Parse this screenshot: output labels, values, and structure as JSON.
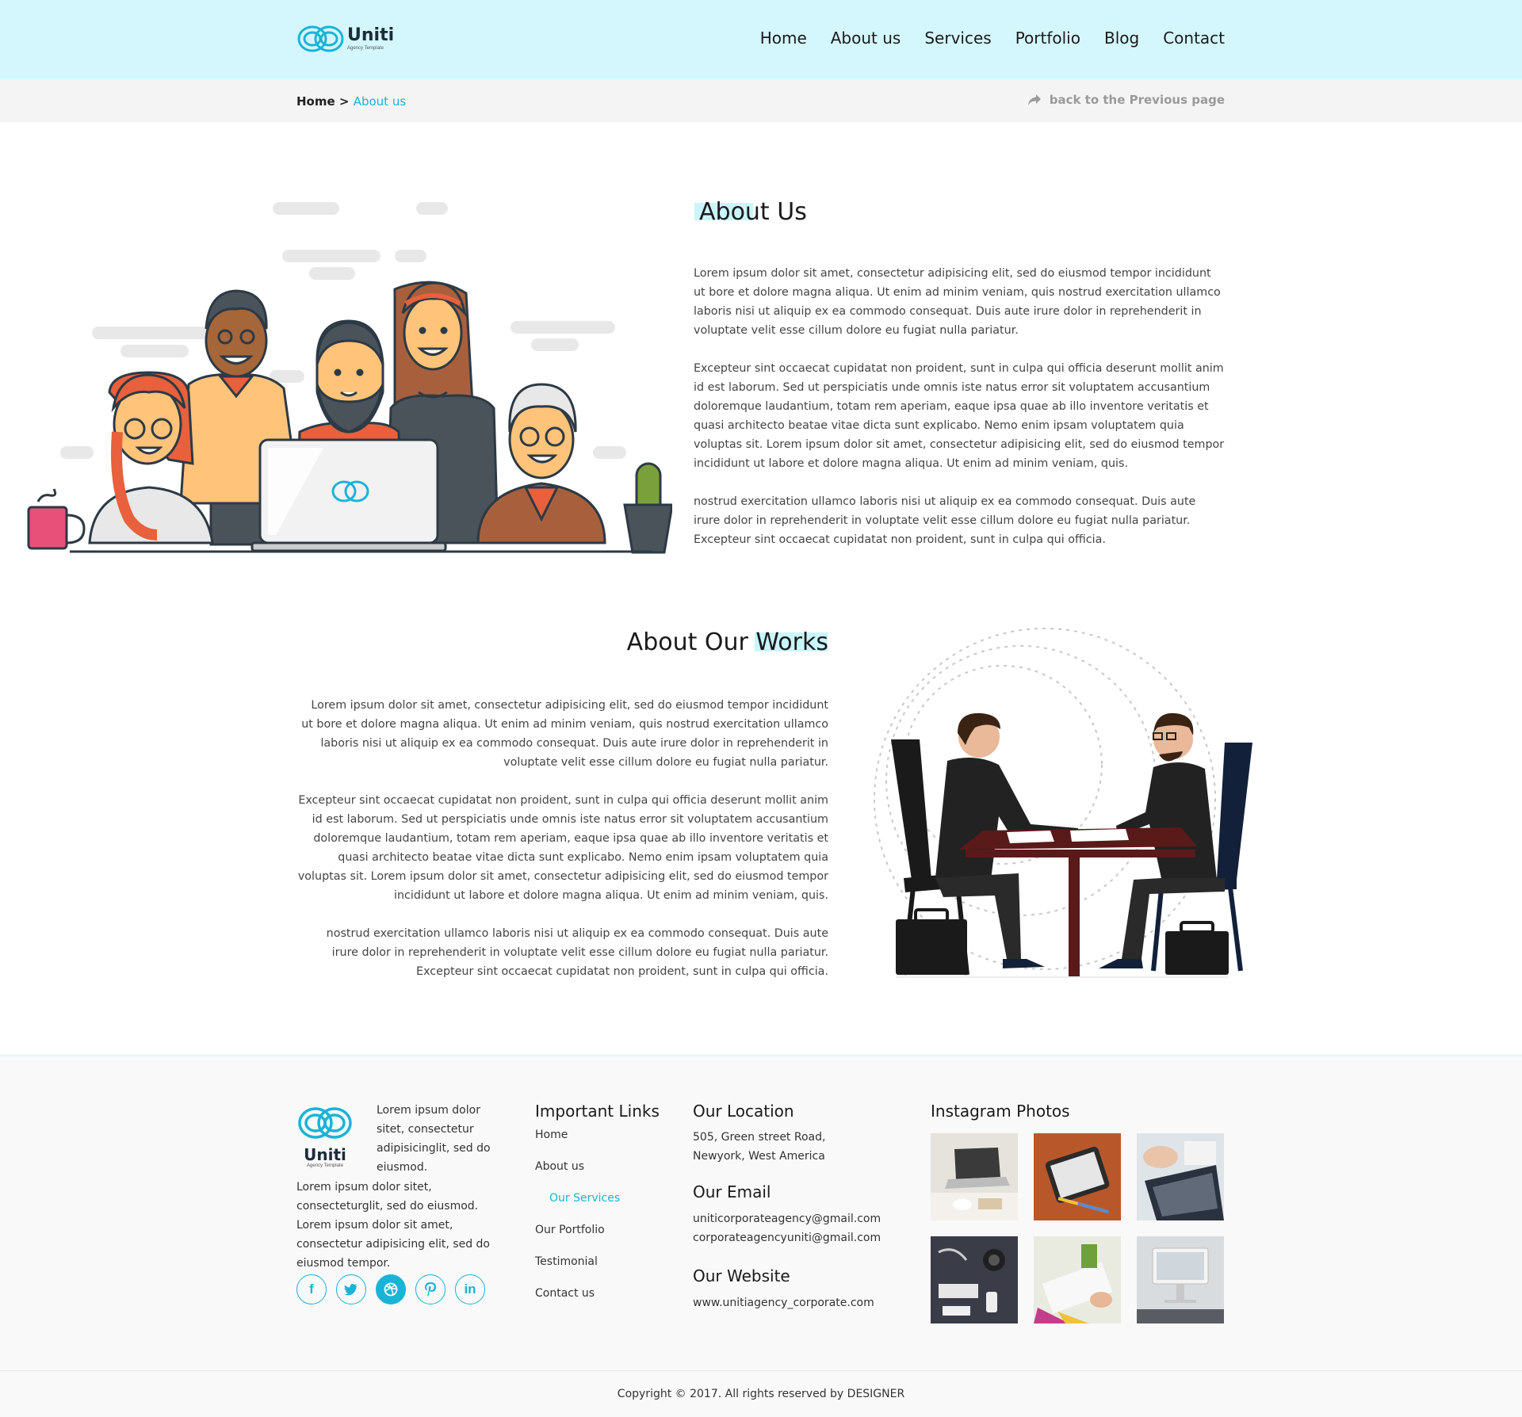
{
  "brand": {
    "name": "Uniti",
    "tagline": "Agency Template"
  },
  "nav": [
    {
      "label": "Home",
      "active": true
    },
    {
      "label": "About us"
    },
    {
      "label": "Services"
    },
    {
      "label": "Portfolio"
    },
    {
      "label": "Blog"
    },
    {
      "label": "Contact"
    }
  ],
  "breadcrumb": {
    "home": "Home",
    "separator": ">",
    "current": "About us",
    "back": "back to the Previous page"
  },
  "about": {
    "title": "About Us",
    "paragraphs": [
      "Lorem ipsum dolor sit amet, consectetur adipisicing elit, sed do eiusmod tempor incididunt ut bore et dolore magna aliqua. Ut enim ad minim veniam, quis nostrud exercitation ullamco laboris nisi ut aliquip ex ea commodo consequat. Duis aute irure dolor in reprehenderit in voluptate velit esse cillum dolore eu fugiat nulla pariatur.",
      "Excepteur sint occaecat cupidatat non proident, sunt in culpa qui officia deserunt mollit anim id est laborum. Sed ut perspiciatis unde omnis iste natus error sit voluptatem accusantium doloremque laudantium, totam rem aperiam, eaque ipsa quae ab illo inventore veritatis et quasi architecto beatae vitae dicta sunt explicabo. Nemo enim ipsam voluptatem quia voluptas sit. Lorem ipsum dolor sit amet, consectetur adipisicing elit, sed do eiusmod tempor incididunt ut labore et dolore magna aliqua. Ut enim ad minim veniam, quis.",
      "nostrud exercitation ullamco laboris nisi ut aliquip ex ea commodo consequat. Duis aute irure dolor in reprehenderit in voluptate velit esse cillum dolore eu fugiat nulla pariatur. Excepteur sint occaecat cupidatat non proident, sunt in culpa qui officia."
    ]
  },
  "works": {
    "title": "About Our Works",
    "paragraphs": [
      "Lorem ipsum dolor sit amet, consectetur adipisicing elit, sed do eiusmod tempor incididunt ut bore et dolore magna aliqua. Ut enim ad minim veniam, quis nostrud exercitation ullamco laboris nisi ut aliquip ex ea commodo consequat. Duis aute irure dolor in reprehenderit in voluptate velit esse cillum dolore eu fugiat nulla pariatur.",
      "Excepteur sint occaecat cupidatat non proident, sunt in culpa qui officia deserunt mollit anim id est laborum. Sed ut perspiciatis unde omnis iste natus error sit voluptatem accusantium doloremque laudantium, totam rem aperiam, eaque ipsa quae ab illo inventore veritatis et quasi architecto beatae vitae dicta sunt explicabo. Nemo enim ipsam voluptatem quia voluptas sit. Lorem ipsum dolor sit amet, consectetur adipisicing elit, sed do eiusmod tempor incididunt ut labore et dolore magna aliqua. Ut enim ad minim veniam, quis.",
      "nostrud exercitation ullamco laboris nisi ut aliquip ex ea commodo consequat. Duis aute irure dolor in reprehenderit in voluptate velit esse cillum dolore eu fugiat nulla pariatur. Excepteur sint occaecat cupidatat non proident, sunt in culpa qui officia."
    ]
  },
  "footer": {
    "about_short": "Lorem ipsum dolor sitet, consectetur adipisicinglit, sed do eiusmod.",
    "about_long": "Lorem ipsum dolor sitet, consecteturglit, sed do eiusmod. Lorem ipsum dolor sit amet, consectetur adipisicing elit, sed do eiusmod tempor.",
    "links_title": "Important Links",
    "links": [
      {
        "label": "Home"
      },
      {
        "label": "About us"
      },
      {
        "label": "Our Services",
        "active": true
      },
      {
        "label": "Our Portfolio"
      },
      {
        "label": "Testimonial"
      },
      {
        "label": "Contact us"
      }
    ],
    "location_title": "Our Location",
    "location": "505, Green street Road, Newyork, West America",
    "email_title": "Our Email",
    "emails": [
      "uniticorporateagency@gmail.com",
      "corporateagencyuniti@gmail.com"
    ],
    "website_title": "Our Website",
    "website": "www.unitiagency_corporate.com",
    "instagram_title": "Instagram Photos",
    "social": [
      "facebook-icon",
      "twitter-icon",
      "dribbble-icon",
      "pinterest-icon",
      "linkedin-icon"
    ]
  },
  "copyright": "Copyright © 2017. All rights reserved by DESIGNER",
  "colors": {
    "accent": "#1ab3d8",
    "header_bg": "#d4f7fd",
    "highlight": "#c9f6fc"
  }
}
